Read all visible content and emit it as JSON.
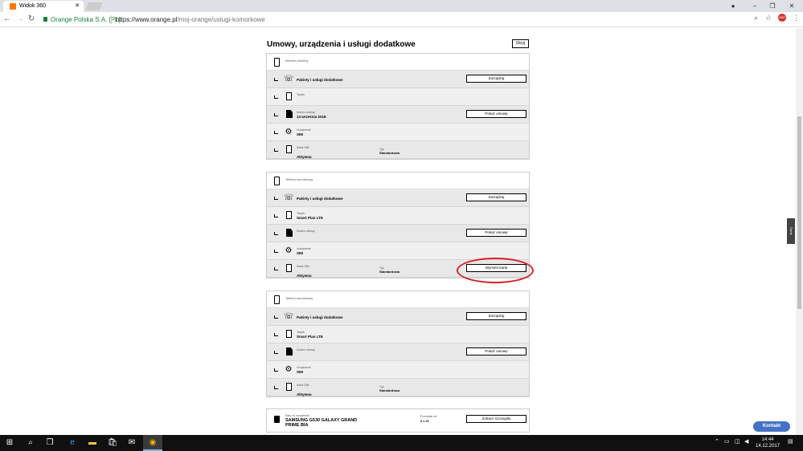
{
  "browser": {
    "tab_title": "Widok 360",
    "secure_label": "Orange Polska S.A. [PL]",
    "url_prefix": "https://www.orange.pl",
    "url_path": "/moj-orange/uslugi-komorkowe",
    "extension_badge": "ABP"
  },
  "page": {
    "heading": "Umowy, urządzenia i usługi dodatkowe",
    "top_button": "Ukryj",
    "side_tab": "Opinie",
    "contact_button": "Kontakt"
  },
  "cards": [
    {
      "type_label": "Internet mobilny",
      "rows": [
        {
          "value": "Pakiety i usługi dodatkowe",
          "button": "Zarządzaj"
        },
        {
          "caption": "Taryfa",
          "value": ""
        },
        {
          "caption": "Koniec umowy",
          "value": "13 września 2018",
          "button": "Pokaż umowę"
        },
        {
          "caption": "Urządzenie",
          "value": "SIM"
        },
        {
          "caption": "Karta SIM",
          "value": "Aktywna",
          "caption2": "Typ",
          "value2": "Standardowa"
        }
      ]
    },
    {
      "type_label": "Telefon komórkowy",
      "rows": [
        {
          "value": "Pakiety i usługi dodatkowe",
          "button": "Zarządzaj"
        },
        {
          "caption": "Taryfa",
          "value": "Smart Plan LTE"
        },
        {
          "caption": "Koniec umowy",
          "value": "",
          "button": "Pokaż umowę"
        },
        {
          "caption": "Urządzenie",
          "value": "SIM"
        },
        {
          "caption": "Karta SIM",
          "value": "Aktywna",
          "caption2": "Typ",
          "value2": "Standardowa",
          "button": "Wymień kartę"
        }
      ]
    },
    {
      "type_label": "Telefon komórkowy",
      "rows": [
        {
          "value": "Pakiety i usługi dodatkowe",
          "button": "Zarządzaj"
        },
        {
          "caption": "Taryfa",
          "value": "Smart Plan LTE"
        },
        {
          "caption": "Koniec umowy",
          "value": "",
          "button": "Pokaż umowę"
        },
        {
          "caption": "Urządzenie",
          "value": "SIM"
        },
        {
          "caption": "Karta SIM",
          "value": "Aktywna",
          "caption2": "Typ",
          "value2": "Standardowa"
        }
      ]
    }
  ],
  "device_card": {
    "caption": "Raty za urządzenie",
    "value": "SAMSUNG G530 GALAXY GRAND PRIME BIA",
    "price_caption": "Pozostało rat",
    "price_value": "0 z 21",
    "button": "Zobacz szczegóły"
  },
  "taskbar": {
    "time": "14:44",
    "date": "14.12.2017"
  }
}
